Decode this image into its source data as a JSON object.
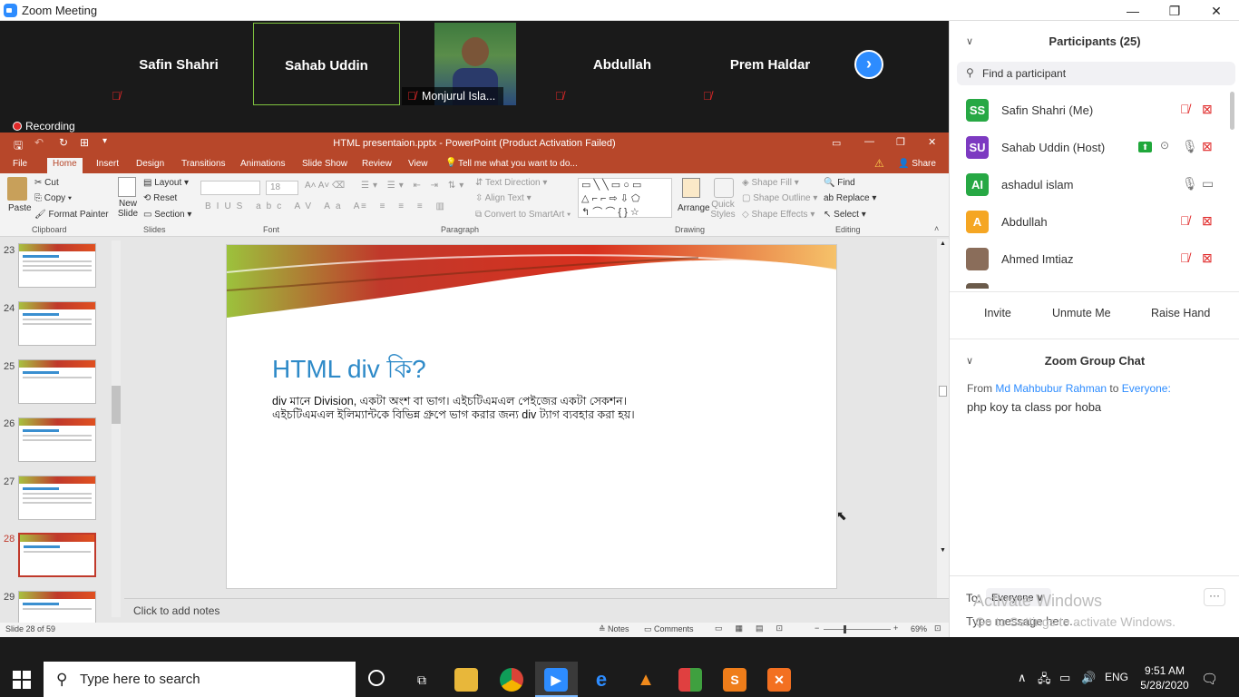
{
  "window": {
    "title": "Zoom Meeting",
    "minimize": "—",
    "restore": "❐",
    "close": "✕"
  },
  "video_strip": {
    "tiles": [
      {
        "name": "Safin Shahri",
        "muted": true
      },
      {
        "name": "Sahab Uddin",
        "muted": false,
        "active": true
      },
      {
        "name": "Monjurul Isla...",
        "muted": true,
        "video": true
      },
      {
        "name": "Abdullah",
        "muted": true
      },
      {
        "name": "Prem Haldar",
        "muted": true
      }
    ],
    "recording_label": "Recording",
    "next_icon": "›"
  },
  "powerpoint": {
    "file_title": "HTML presentaion.pptx  -  PowerPoint (Product Activation Failed)",
    "tabs": [
      "File",
      "Home",
      "Insert",
      "Design",
      "Transitions",
      "Animations",
      "Slide Show",
      "Review",
      "View"
    ],
    "tell_me": "Tell me what you want to do...",
    "share": "Share",
    "ribbon": {
      "clipboard": {
        "paste": "Paste",
        "cut": "Cut",
        "copy": "Copy",
        "format_painter": "Format Painter",
        "label": "Clipboard"
      },
      "slides": {
        "new_slide": "New Slide",
        "layout": "Layout",
        "reset": "Reset",
        "section": "Section",
        "label": "Slides"
      },
      "font": {
        "size": "18",
        "label": "Font"
      },
      "paragraph": {
        "text_direction": "Text Direction",
        "align_text": "Align Text",
        "convert": "Convert to SmartArt",
        "label": "Paragraph"
      },
      "drawing": {
        "arrange": "Arrange",
        "quick_styles": "Quick Styles",
        "shape_fill": "Shape Fill",
        "shape_outline": "Shape Outline",
        "shape_effects": "Shape Effects",
        "label": "Drawing"
      },
      "editing": {
        "find": "Find",
        "replace": "Replace",
        "select": "Select",
        "label": "Editing"
      }
    },
    "thumbnail_numbers": [
      "23",
      "24",
      "25",
      "26",
      "27",
      "28",
      "29"
    ],
    "selected_slide": "28",
    "slide": {
      "title": "HTML div কি?",
      "body_line1": "div মানে Division, একটা অংশ বা ভাগ। এইচটিএমএল পেইজের একটা সেকশন।",
      "body_line2": "এইচটিএমএল ইলিম্যান্টকে বিভিন্ন গ্রুপে ভাগ করার জন্য div ট্যাগ ব্যবহার করা হয়।"
    },
    "notes_placeholder": "Click to add notes",
    "status": {
      "slide_count": "Slide 28 of 59",
      "notes": "Notes",
      "comments": "Comments",
      "zoom": "69%"
    }
  },
  "participants_panel": {
    "header": "Participants (25)",
    "search_placeholder": "Find a participant",
    "participants": [
      {
        "initials": "SS",
        "name": "Safin Shahri (Me)",
        "color": "#27a844"
      },
      {
        "initials": "SU",
        "name": "Sahab Uddin (Host)",
        "color": "#7d3ac1"
      },
      {
        "initials": "AI",
        "name": "ashadul islam",
        "color": "#27a844"
      },
      {
        "initials": "A",
        "name": "Abdullah",
        "color": "#f5a623"
      },
      {
        "initials": "",
        "name": "Ahmed Imtiaz",
        "color": "#8a6d5a"
      }
    ],
    "buttons": [
      "Invite",
      "Unmute Me",
      "Raise Hand"
    ]
  },
  "chat": {
    "header": "Zoom Group Chat",
    "from_label": "From",
    "sender": "Md Mahbubur Rahman",
    "to_label": "to",
    "recipient": "Everyone:",
    "message": "php koy ta class por hoba",
    "to_prefix": "To:",
    "to_value": "Everyone",
    "placeholder": "Type message here...",
    "more": "···"
  },
  "activate": {
    "line1": "Activate Windows",
    "line2": "Go to Settings to activate Windows."
  },
  "taskbar": {
    "search_placeholder": "Type here to search",
    "language": "ENG",
    "time": "9:51 AM",
    "date": "5/28/2020"
  }
}
